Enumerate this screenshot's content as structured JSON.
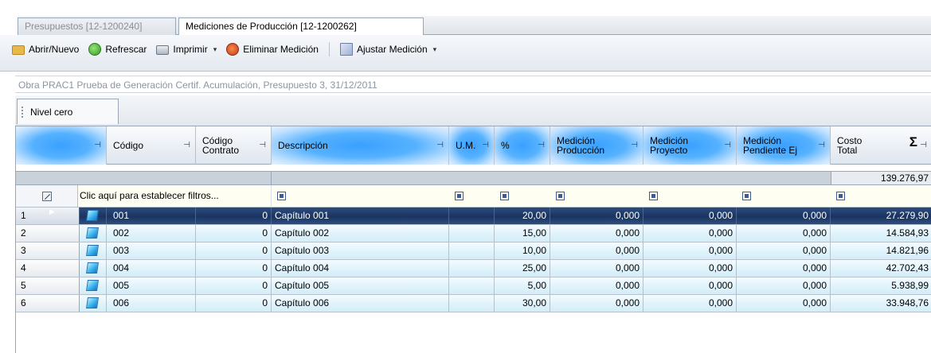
{
  "tabs": [
    {
      "label": "Presupuestos [12-1200240]"
    },
    {
      "label": "Mediciones de Producción [12-1200262]"
    }
  ],
  "toolbar": {
    "open": "Abrir/Nuevo",
    "refresh": "Refrescar",
    "print": "Imprimir",
    "delete": "Eliminar Medición",
    "adjust": "Ajustar Medición",
    "caret": "▾"
  },
  "info_bar": "Obra PRAC1 Prueba de Generación Certif. Acumulación,  Presupuesto 3, 31/12/2011",
  "level_button": "Nivel cero",
  "columns": [
    {
      "label": ""
    },
    {
      "label": "Código"
    },
    {
      "label": "Código\nContrato"
    },
    {
      "label": "Descripción"
    },
    {
      "label": "U.M."
    },
    {
      "label": "%"
    },
    {
      "label": "Medición\nProducción"
    },
    {
      "label": "Medición\nProyecto"
    },
    {
      "label": "Medición\nPendiente Ej"
    },
    {
      "label": "Costo\nTotal"
    }
  ],
  "pin_glyph": "⊣",
  "sigma": "Σ",
  "summary_total": "139.276,97",
  "filter_prompt": "Clic aquí para establecer filtros...",
  "rows": [
    {
      "num": "1",
      "codigo": "001",
      "contrato": "0",
      "desc": "Capítulo 001",
      "pct": "20,00",
      "prod": "0,000",
      "proy": "0,000",
      "pend": "0,000",
      "costo": "27.279,90",
      "selected": true
    },
    {
      "num": "2",
      "codigo": "002",
      "contrato": "0",
      "desc": "Capítulo 002",
      "pct": "15,00",
      "prod": "0,000",
      "proy": "0,000",
      "pend": "0,000",
      "costo": "14.584,93"
    },
    {
      "num": "3",
      "codigo": "003",
      "contrato": "0",
      "desc": "Capítulo 003",
      "pct": "10,00",
      "prod": "0,000",
      "proy": "0,000",
      "pend": "0,000",
      "costo": "14.821,96"
    },
    {
      "num": "4",
      "codigo": "004",
      "contrato": "0",
      "desc": "Capítulo 004",
      "pct": "25,00",
      "prod": "0,000",
      "proy": "0,000",
      "pend": "0,000",
      "costo": "42.702,43"
    },
    {
      "num": "5",
      "codigo": "005",
      "contrato": "0",
      "desc": "Capítulo 005",
      "pct": "5,00",
      "prod": "0,000",
      "proy": "0,000",
      "pend": "0,000",
      "costo": "5.938,99"
    },
    {
      "num": "6",
      "codigo": "006",
      "contrato": "0",
      "desc": "Capítulo 006",
      "pct": "30,00",
      "prod": "0,000",
      "proy": "0,000",
      "pend": "0,000",
      "costo": "33.948,76"
    }
  ],
  "row_arrow": "▶",
  "colors": {
    "selected_row": "#1a3461",
    "header_accent": "#3aa0ff",
    "row_band": "#dff3fb"
  }
}
